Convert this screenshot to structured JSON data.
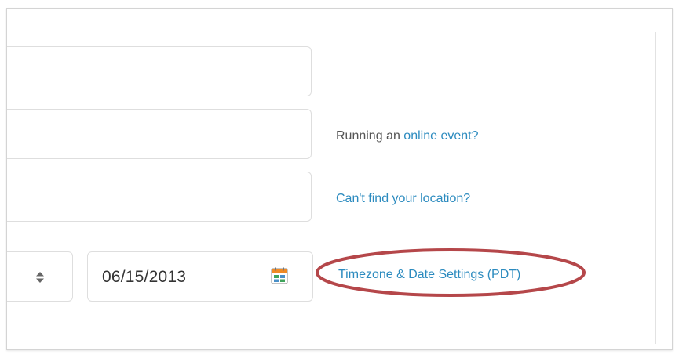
{
  "form": {
    "online_event": {
      "prefix": "Running an ",
      "link_label": "online event?"
    },
    "location_help": {
      "link_label": "Can't find your location?"
    },
    "date": {
      "value": "06/15/2013"
    },
    "timezone": {
      "link_label": "Timezone & Date Settings (PDT)",
      "highlight_color": "#b5474a"
    }
  },
  "icons": {
    "stepper": "up-down-stepper-icon",
    "calendar": "calendar-icon"
  },
  "colors": {
    "link": "#2c8bbf",
    "text": "#555555",
    "border": "#dedede"
  }
}
